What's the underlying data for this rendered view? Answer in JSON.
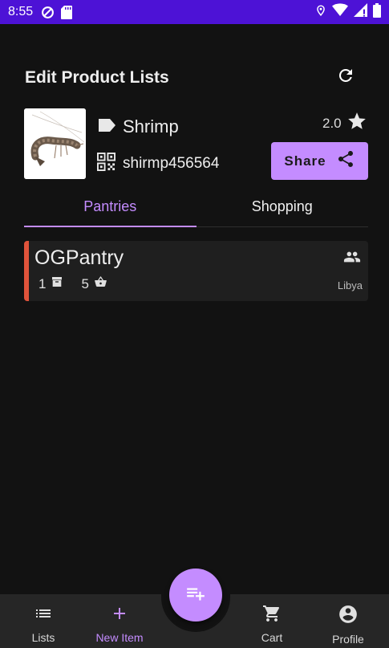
{
  "status_bar": {
    "time": "8:55",
    "left_icons": [
      "do-not-disturb-icon",
      "sd-card-icon"
    ],
    "right_icons": [
      "location-icon",
      "wifi-icon",
      "signal-icon",
      "battery-icon"
    ]
  },
  "header": {
    "title": "Edit Product Lists",
    "refresh_icon": "refresh-icon"
  },
  "product": {
    "name": "Shrimp",
    "code": "shirmp456564",
    "rating": "2.0",
    "share_label": "Share"
  },
  "tabs": [
    {
      "label": "Pantries",
      "active": true
    },
    {
      "label": "Shopping",
      "active": false
    }
  ],
  "pantries": [
    {
      "name": "OGPantry",
      "storage_count": "1",
      "item_count": "5",
      "location": "Libya",
      "accent_color": "#e0533b"
    }
  ],
  "bottom_nav": {
    "items": [
      {
        "label": "Lists",
        "icon": "list-icon",
        "active": false
      },
      {
        "label": "New Item",
        "icon": "plus-icon",
        "active": true
      },
      {
        "label": "Cart",
        "icon": "cart-icon",
        "active": false
      },
      {
        "label": "Profile",
        "icon": "account-circle-icon",
        "active": false
      }
    ],
    "fab_icon": "playlist-add-icon"
  },
  "colors": {
    "status_bar": "#4d12d6",
    "accent": "#c48cff",
    "background": "#121212",
    "card": "#1f1f1f",
    "pantry_accent": "#e0533b"
  }
}
